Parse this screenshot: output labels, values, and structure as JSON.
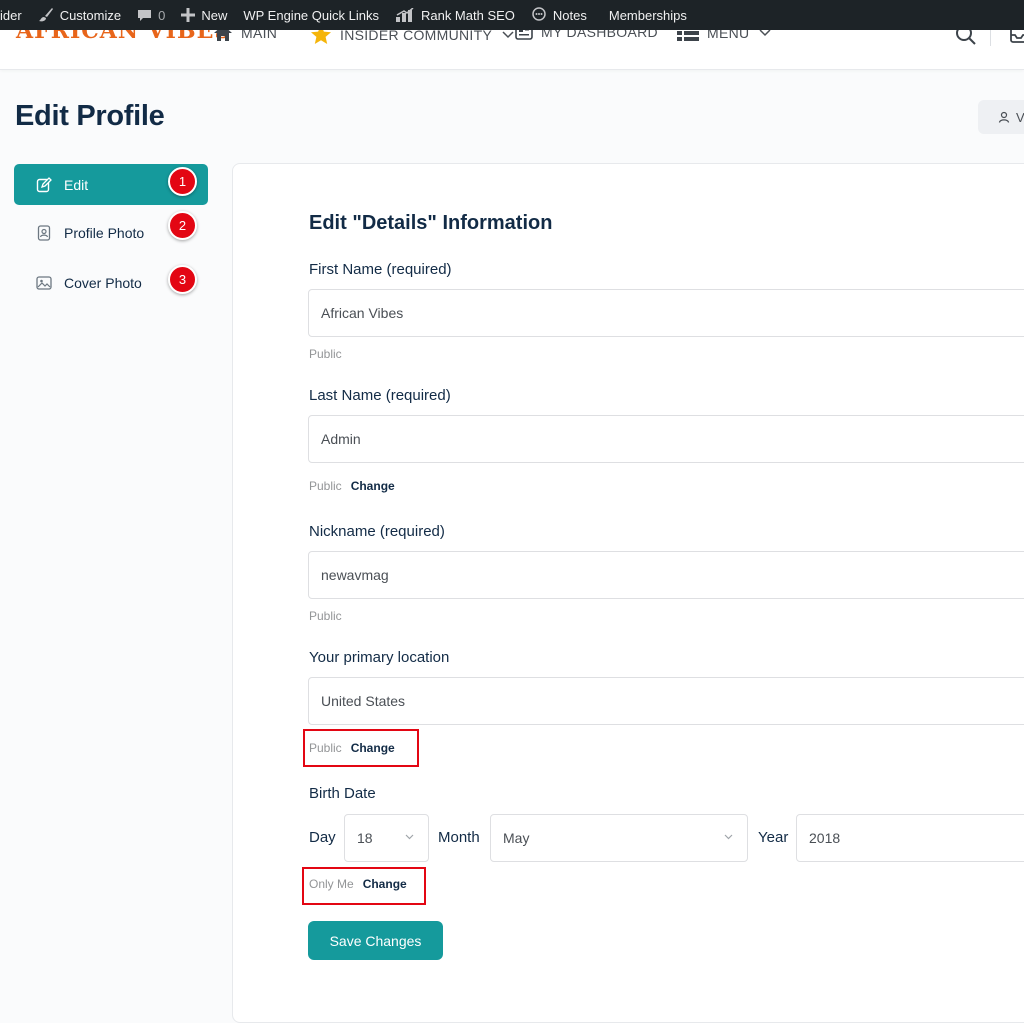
{
  "admin_bar": {
    "site_fragment": "ider",
    "customize": "Customize",
    "comments_count": "0",
    "new": "New",
    "wp_engine": "WP Engine Quick Links",
    "rank_math": "Rank Math SEO",
    "notes": "Notes",
    "memberships": "Memberships"
  },
  "site_header": {
    "logo": "AFRICAN VIBES",
    "nav": {
      "main": "MAIN",
      "insider": "INSIDER COMMUNITY",
      "dashboard": "MY DASHBOARD",
      "menu": "MENU"
    }
  },
  "page": {
    "title": "Edit Profile",
    "view_button": "V"
  },
  "sidebar": {
    "items": [
      {
        "label": "Edit",
        "icon": "edit-icon",
        "badge": "1"
      },
      {
        "label": "Profile Photo",
        "icon": "profile-photo-icon",
        "badge": "2"
      },
      {
        "label": "Cover Photo",
        "icon": "cover-photo-icon",
        "badge": "3"
      }
    ]
  },
  "form": {
    "heading": "Edit \"Details\" Information",
    "first_name": {
      "label": "First Name (required)",
      "value": "African Vibes",
      "visibility": "Public"
    },
    "last_name": {
      "label": "Last Name (required)",
      "value": "Admin",
      "visibility": "Public",
      "change": "Change"
    },
    "nickname": {
      "label": "Nickname (required)",
      "value": "newavmag",
      "visibility": "Public"
    },
    "location": {
      "label": "Your primary location",
      "value": "United States",
      "visibility": "Public",
      "change": "Change"
    },
    "birth_date": {
      "label": "Birth Date",
      "day_label": "Day",
      "day_value": "18",
      "month_label": "Month",
      "month_value": "May",
      "year_label": "Year",
      "year_value": "2018",
      "visibility": "Only Me",
      "change": "Change"
    },
    "save": "Save Changes"
  },
  "colors": {
    "accent": "#159a9c",
    "annotation_red": "#e30613",
    "admin_bar": "#1d2327",
    "heading": "#122b46"
  }
}
